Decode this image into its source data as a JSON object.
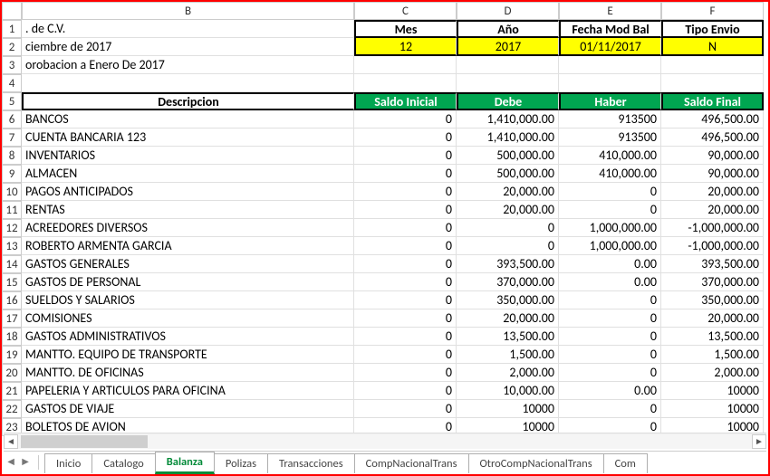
{
  "columns": [
    "B",
    "C",
    "D",
    "E",
    "F"
  ],
  "row_nums": [
    "1",
    "2",
    "3",
    "4",
    "5",
    "6",
    "7",
    "8",
    "9",
    "10",
    "11",
    "12",
    "13",
    "14",
    "15",
    "16",
    "17",
    "18",
    "19",
    "20",
    "21",
    "22",
    "23"
  ],
  "top": {
    "r1_b": ". de C.V.",
    "r1_c": "Mes",
    "r1_d": "Año",
    "r1_e": "Fecha Mod Bal",
    "r1_f": "Tipo Envio",
    "r2_b": "ciembre de 2017",
    "r2_c": "12",
    "r2_d": "2017",
    "r2_e": "01/11/2017",
    "r2_f": "N",
    "r3_b": "orobacion a Enero De 2017"
  },
  "headers": {
    "b": "Descripcion",
    "c": "Saldo Inicial",
    "d": "Debe",
    "e": "Haber",
    "f": "Saldo Final"
  },
  "rows": [
    {
      "b": "BANCOS",
      "c": "0",
      "d": "1,410,000.00",
      "e": "913500",
      "f": "496,500.00"
    },
    {
      "b": "CUENTA BANCARIA 123",
      "c": "0",
      "d": "1,410,000.00",
      "e": "913500",
      "f": "496,500.00"
    },
    {
      "b": "INVENTARIOS",
      "c": "0",
      "d": "500,000.00",
      "e": "410,000.00",
      "f": "90,000.00"
    },
    {
      "b": "ALMACEN",
      "c": "0",
      "d": "500,000.00",
      "e": "410,000.00",
      "f": "90,000.00"
    },
    {
      "b": "PAGOS ANTICIPADOS",
      "c": "0",
      "d": "20,000.00",
      "e": "0",
      "f": "20,000.00"
    },
    {
      "b": "RENTAS",
      "c": "0",
      "d": "20,000.00",
      "e": "0",
      "f": "20,000.00"
    },
    {
      "b": "ACREEDORES DIVERSOS",
      "c": "0",
      "d": "0",
      "e": "1,000,000.00",
      "f": "-1,000,000.00"
    },
    {
      "b": "ROBERTO ARMENTA GARCIA",
      "c": "0",
      "d": "0",
      "e": "1,000,000.00",
      "f": "-1,000,000.00"
    },
    {
      "b": "GASTOS GENERALES",
      "c": "0",
      "d": "393,500.00",
      "e": "0.00",
      "f": "393,500.00"
    },
    {
      "b": "GASTOS DE PERSONAL",
      "c": "0",
      "d": "370,000.00",
      "e": "0.00",
      "f": "370,000.00"
    },
    {
      "b": "SUELDOS Y SALARIOS",
      "c": "0",
      "d": "350,000.00",
      "e": "0",
      "f": "350,000.00"
    },
    {
      "b": "COMISIONES",
      "c": "0",
      "d": "20,000.00",
      "e": "0",
      "f": "20,000.00"
    },
    {
      "b": "GASTOS ADMINISTRATIVOS",
      "c": "0",
      "d": "13,500.00",
      "e": "0",
      "f": "13,500.00"
    },
    {
      "b": "MANTTO. EQUIPO DE TRANSPORTE",
      "c": "0",
      "d": "1,500.00",
      "e": "0",
      "f": "1,500.00"
    },
    {
      "b": "MANTTO. DE OFICINAS",
      "c": "0",
      "d": "2,000.00",
      "e": "0",
      "f": "2,000.00"
    },
    {
      "b": "PAPELERIA Y ARTICULOS PARA OFICINA",
      "c": "0",
      "d": "10,000.00",
      "e": "0.00",
      "f": "10000"
    },
    {
      "b": "GASTOS DE VIAJE",
      "c": "0",
      "d": "10000",
      "e": "0",
      "f": "10000"
    },
    {
      "b": "BOLETOS DE AVION",
      "c": "0",
      "d": "10000",
      "e": "0",
      "f": "10000"
    }
  ],
  "tabs": [
    "Inicio",
    "Catalogo",
    "Balanza",
    "Polizas",
    "Transacciones",
    "CompNacionalTrans",
    "OtroCompNacionalTrans",
    "Com"
  ],
  "active_tab": "Balanza"
}
